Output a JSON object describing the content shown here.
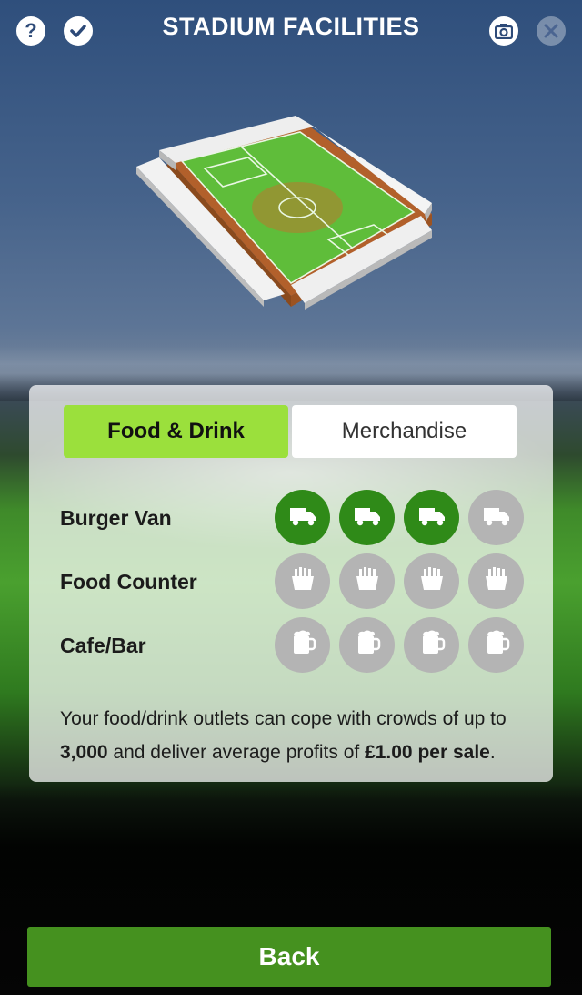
{
  "header": {
    "title": "STADIUM FACILITIES",
    "left_icons": [
      "help-icon",
      "check-icon"
    ],
    "right_icons": [
      "camera-icon",
      "settings-icon"
    ]
  },
  "tabs": [
    {
      "label": "Food & Drink",
      "active": true
    },
    {
      "label": "Merchandise",
      "active": false
    }
  ],
  "facilities": [
    {
      "label": "Burger Van",
      "icon": "truck-icon",
      "level": 3,
      "max": 4
    },
    {
      "label": "Food Counter",
      "icon": "fries-icon",
      "level": 0,
      "max": 4
    },
    {
      "label": "Cafe/Bar",
      "icon": "beer-mug-icon",
      "level": 0,
      "max": 4
    }
  ],
  "description": {
    "part1": "Your food/drink outlets can cope with crowds of up to ",
    "capacity": "3,000",
    "part2": " and deliver average profits of ",
    "profit": "£1.00 per sale",
    "part3": "."
  },
  "back_button": {
    "label": "Back"
  },
  "colors": {
    "accent_green": "#9be03c",
    "level_on": "#2f8a18",
    "level_off": "#b4b4b4",
    "back_button": "#45911f"
  }
}
